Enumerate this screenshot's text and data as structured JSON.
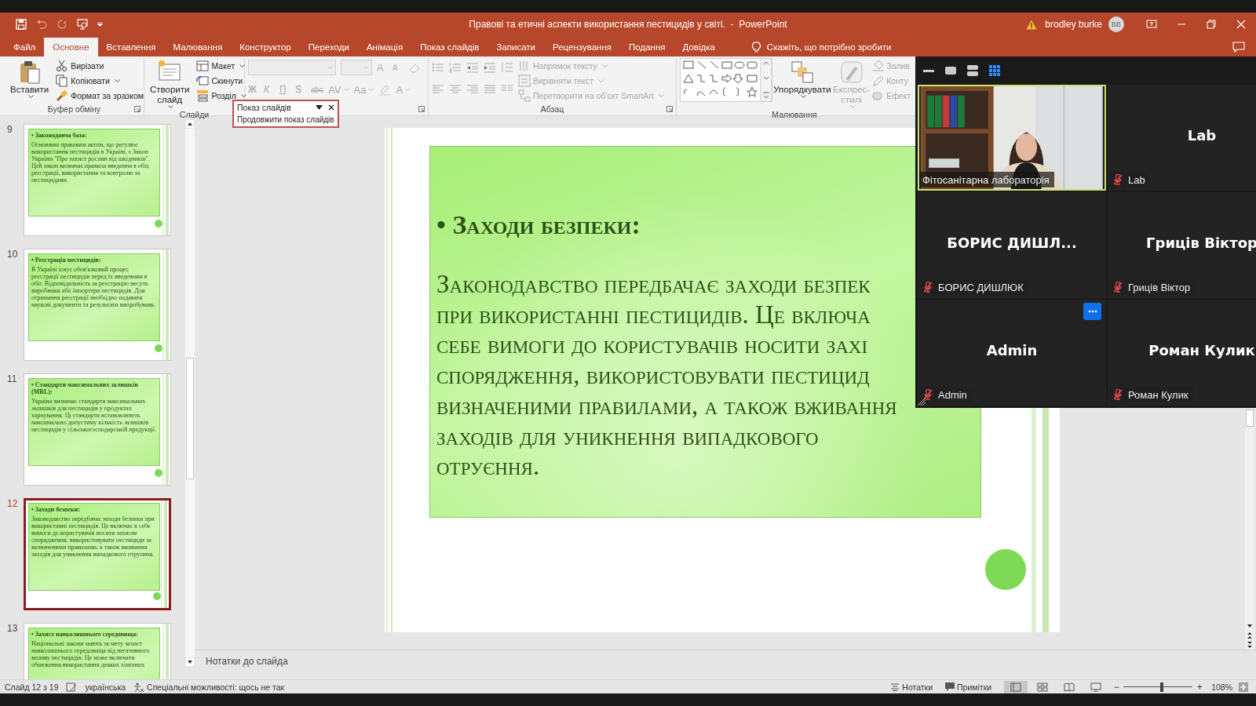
{
  "window": {
    "title": "Правові та етичні аспекти використання пестицидів у світі.  -  PowerPoint",
    "user": "brodley burke",
    "avatar": "BB"
  },
  "tabs": [
    {
      "label": "Файл",
      "selected": false
    },
    {
      "label": "Основне",
      "selected": true
    },
    {
      "label": "Вставлення",
      "selected": false
    },
    {
      "label": "Малювання",
      "selected": false
    },
    {
      "label": "Конструктор",
      "selected": false
    },
    {
      "label": "Переходи",
      "selected": false
    },
    {
      "label": "Анімація",
      "selected": false
    },
    {
      "label": "Показ слайдів",
      "selected": false
    },
    {
      "label": "Записати",
      "selected": false
    },
    {
      "label": "Рецензування",
      "selected": false
    },
    {
      "label": "Подання",
      "selected": false
    },
    {
      "label": "Довідка",
      "selected": false
    }
  ],
  "tell_me": "Скажіть, що потрібно зробити",
  "ribbon": [
    {
      "kind": "clipboard",
      "label": "Буфер обміну",
      "large": [
        {
          "label": "Вставити",
          "menu": true,
          "disabled": false
        }
      ],
      "small": [
        {
          "label": "Вирізати",
          "menu": false,
          "disabled": false
        },
        {
          "label": "Копіювати",
          "menu": true,
          "disabled": false
        },
        {
          "label": "Формат за зразком",
          "menu": false,
          "disabled": false
        }
      ]
    },
    {
      "kind": "slides",
      "label": "Слайди",
      "large": [
        {
          "label": "Створити слайд",
          "menu": true,
          "disabled": false
        }
      ],
      "small": [
        {
          "label": "Макет",
          "menu": true,
          "disabled": false
        },
        {
          "label": "Скинути",
          "menu": false,
          "disabled": false
        },
        {
          "label": "Розділ",
          "menu": true,
          "disabled": false
        }
      ]
    },
    {
      "kind": "font",
      "grow": [
        {
          "label": "A",
          "kind": "grow",
          "disabled": true
        },
        {
          "label": "A",
          "kind": "shrink",
          "disabled": true
        }
      ],
      "glyphs": [
        {
          "label": "Ж",
          "kind": "bold",
          "disabled": true
        },
        {
          "label": "К",
          "kind": "italic",
          "disabled": true
        },
        {
          "label": "П",
          "kind": "underline",
          "disabled": true
        },
        {
          "label": "S",
          "kind": "shadow",
          "disabled": true
        },
        {
          "label": "abc",
          "kind": "strike",
          "disabled": true
        },
        {
          "label": "AV",
          "kind": "spacing",
          "disabled": true
        },
        {
          "label": "Aa",
          "kind": "case",
          "disabled": true
        },
        {
          "label": "A",
          "kind": "color",
          "disabled": true
        }
      ]
    },
    {
      "kind": "paragraph",
      "label": "Абзац",
      "small": [
        {
          "label": "Напрямок тексту",
          "menu": true,
          "disabled": true
        },
        {
          "label": "Вирівняти текст",
          "menu": true,
          "disabled": true
        },
        {
          "label": "Перетворити на об'єкт SmartArt",
          "menu": true,
          "disabled": true
        }
      ]
    },
    {
      "kind": "drawing",
      "label": "Малювання",
      "large": [
        {
          "label": "Упорядкувати",
          "menu": true,
          "disabled": false
        },
        {
          "label": "Експрес-стилі",
          "menu": true,
          "disabled": true
        }
      ],
      "small": [
        {
          "label": "Залив",
          "menu": false,
          "disabled": true
        },
        {
          "label": "Конту",
          "menu": false,
          "disabled": true
        },
        {
          "label": "Ефект",
          "menu": false,
          "disabled": true
        }
      ]
    }
  ],
  "popup": {
    "title": "Показ слайдів",
    "item": "Продовжити показ слайдів"
  },
  "slides": [
    {
      "number": "9",
      "selected": false,
      "title": "• Законодавча база:",
      "body": "Основним правовим актом, що регулює використання пестицидів в Україні, є Закон України \"Про захист рослин від шкідників\". Цей закон визначає правила введення в обіг, реєстрації, використання та контролю за пестицидами."
    },
    {
      "number": "10",
      "selected": false,
      "title": "• Реєстрація пестицидів:",
      "body": "В Україні існує обов'язковий процес реєстрації пестицидів перед їх введенням в обіг. Відповідальність за реєстрацію несуть виробники або імпортери пестицидів. Для отримання реєстрації необхідно подавати наукові документи та результати випробувань."
    },
    {
      "number": "11",
      "selected": false,
      "title": "• Стандарти максимальних залишків (MRL):",
      "body": "Україна визначає стандарти максимальних залишків для пестицидів у продуктах харчування. Ці стандарти встановлюють максимально допустиму кількість залишків пестицидів у сільськогосподарській продукції."
    },
    {
      "number": "12",
      "selected": true,
      "title": "• Заходи безпеки:",
      "body": "Законодавство передбачає заходи безпеки при використанні пестицидів. Це включає в себе вимоги до користувачів носити захисне спорядження, використовувати пестициди за визначеними правилами, а також вживання заходів для уникнення випадкового отруєння."
    },
    {
      "number": "13",
      "selected": false,
      "title": "• Захист навколишнього середовища:",
      "body": "Національні закони мають за мету захист навколишнього середовища від негативного впливу пестицидів. Це може включати обмеження використання деяких хімічних"
    }
  ],
  "slide": {
    "title": "• Заходи безпеки:",
    "lines": [
      "Законодавство передбачає заходи безпек",
      "при використанні пестицидів. Це включа",
      "себе вимоги до користувачів носити захі",
      "спорядження, використовувати пестицид",
      "визначеними правилами, а також вживання",
      "заходів для уникнення випадкового",
      "отруєння."
    ]
  },
  "notes_placeholder": "Нотатки до слайда",
  "status_bar": {
    "slide": "Слайд 12 з 19",
    "language": "українська",
    "accessibility": "Спеціальні можливості: щось не так",
    "notes": "Нотатки",
    "comments": "Примітки",
    "views": [
      {
        "kind": "normal",
        "selected": true
      },
      {
        "kind": "sorter",
        "selected": false
      },
      {
        "kind": "reading",
        "selected": false
      },
      {
        "kind": "show",
        "selected": false
      }
    ],
    "zoom_out": "−",
    "zoom_in": "+",
    "zoom_slider": {
      "level": 0.55
    },
    "zoom": "108%"
  },
  "meeting": {
    "views": [
      {
        "kind": "minimize",
        "selected": false
      },
      {
        "kind": "speaker",
        "selected": false
      },
      {
        "kind": "strip",
        "selected": false
      },
      {
        "kind": "gallery",
        "selected": true
      }
    ],
    "tiles": [
      {
        "kind": "video",
        "name": "Фітосанітарна лабораторія",
        "active": true,
        "muted": false,
        "menu": false
      },
      {
        "kind": "avatar",
        "display": "Lab",
        "name": "Lab",
        "active": false,
        "muted": true,
        "menu": false
      },
      {
        "kind": "avatar",
        "display": "БОРИС ДИШЛ...",
        "name": "БОРИС ДИШЛЮК",
        "active": false,
        "muted": true,
        "menu": false
      },
      {
        "kind": "avatar",
        "display": "Гриців Віктор",
        "name": "Гриців Віктор",
        "active": false,
        "muted": true,
        "menu": false
      },
      {
        "kind": "avatar",
        "display": "Admin",
        "name": "Admin",
        "active": false,
        "muted": true,
        "menu": true
      },
      {
        "kind": "avatar",
        "display": "Роман Кулик",
        "name": "Роман Кулик",
        "active": false,
        "muted": true,
        "menu": false
      }
    ]
  }
}
